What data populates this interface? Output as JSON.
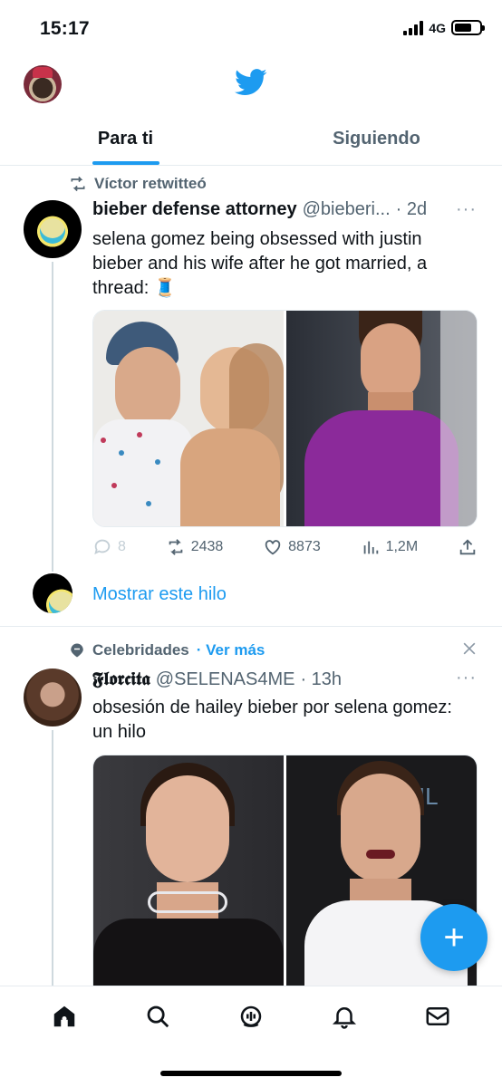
{
  "status_bar": {
    "time": "15:17",
    "network": "4G"
  },
  "tabs": [
    {
      "label": "Para ti",
      "active": true
    },
    {
      "label": "Siguiendo",
      "active": false
    }
  ],
  "tweets": [
    {
      "context": "Víctor retwitteó",
      "name": "bieber defense attorney",
      "handle": "@bieberi...",
      "time": "· 2d",
      "more": "···",
      "text": "selena gomez being obsessed with justin bieber and his wife after he got married, a thread: 🧵",
      "replies": "8",
      "retweets": "2438",
      "likes": "8873",
      "views": "1,2M",
      "show_thread": "Mostrar este hilo"
    },
    {
      "context": "Celebridades",
      "context_link": "· Ver más",
      "name": "𝕱𝖑𝖔𝖗𝖈𝖎𝖙𝖆",
      "handle": "@SELENAS4ME",
      "time": "· 13h",
      "more": "···",
      "text": "obsesión de hailey bieber por selena gomez: un hilo"
    }
  ],
  "fab": {
    "label": "+"
  },
  "colors": {
    "accent": "#1d9bf0",
    "secondary_text": "#536471",
    "divider": "#e6ecf0"
  }
}
